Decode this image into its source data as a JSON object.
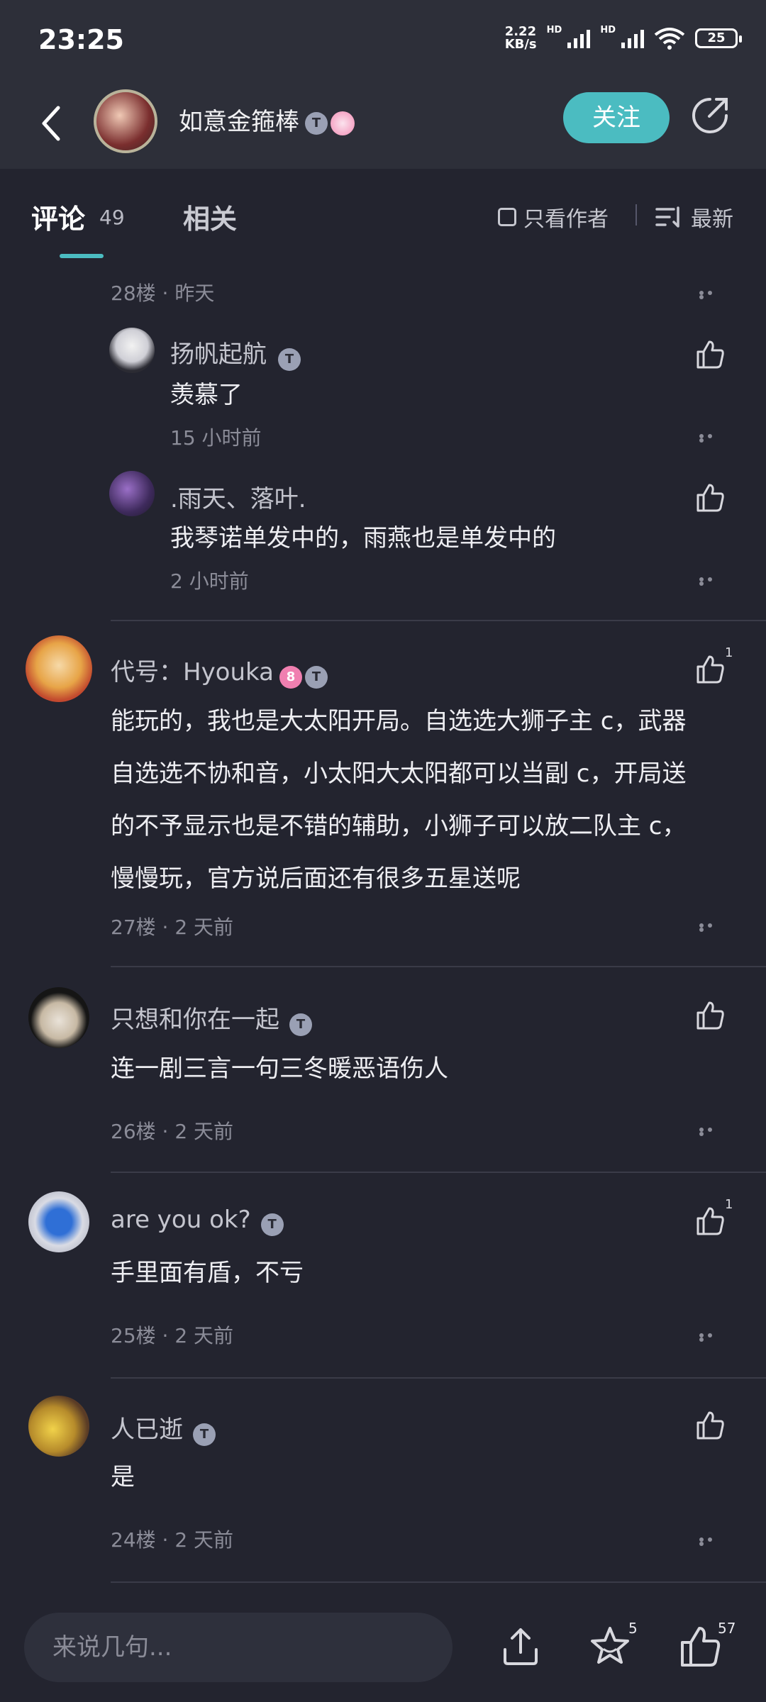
{
  "status": {
    "time": "23:25",
    "speed_top": "2.22",
    "speed_bottom": "KB/s",
    "hd1": "HD",
    "hd2": "HD",
    "battery": "25"
  },
  "header": {
    "username": "如意金箍棒",
    "badge": "T",
    "follow": "关注"
  },
  "tabs": {
    "comments_label": "评论",
    "comments_count": "49",
    "related_label": "相关",
    "only_author": "只看作者",
    "sort": "最新"
  },
  "parent_meta": "28楼 · 昨天",
  "replies": [
    {
      "name": "扬帆起航",
      "badge": "T",
      "text": "羡慕了",
      "time": "15 小时前"
    },
    {
      "name": ".雨天、落叶.",
      "text": "我琴诺单发中的，雨燕也是单发中的",
      "time": "2 小时前"
    }
  ],
  "comments": [
    {
      "name": "代号：Hyouka",
      "level_badge": "8",
      "badge": "T",
      "likes": "1",
      "text_lines": [
        "能玩的，我也是大太阳开局。自选选大狮子主 c，武器",
        "自选选不协和音，小太阳大太阳都可以当副 c，开局送",
        "的不予显示也是不错的辅助，小狮子可以放二队主 c，",
        "慢慢玩，官方说后面还有很多五星送呢"
      ],
      "meta": "27楼 · 2 天前"
    },
    {
      "name": "只想和你在一起",
      "badge": "T",
      "likes": "",
      "text": "连一剧三言一句三冬暖恶语伤人",
      "meta": "26楼 · 2 天前"
    },
    {
      "name": "are you ok?",
      "badge": "T",
      "likes": "1",
      "text": "手里面有盾，不亏",
      "meta": "25楼 · 2 天前"
    },
    {
      "name": "人已逝",
      "badge": "T",
      "likes": "",
      "text": "是",
      "meta": "24楼 · 2 天前"
    }
  ],
  "bottom": {
    "placeholder": "来说几句...",
    "star_count": "5",
    "like_count": "57"
  },
  "colors": {
    "accent": "#4bbcc1",
    "background": "#23242f",
    "header": "#2d2f39"
  }
}
